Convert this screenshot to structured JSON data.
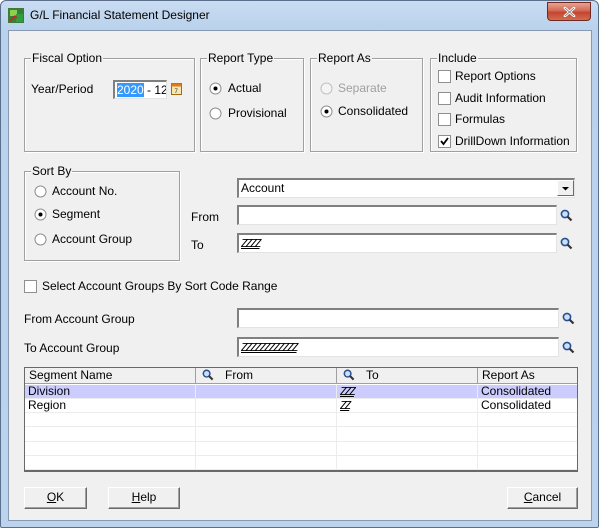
{
  "window": {
    "title": "G/L Financial Statement Designer",
    "icon": "app-icon",
    "close_icon": "close-icon"
  },
  "fiscal_option": {
    "legend": "Fiscal Option",
    "label": "Year/Period",
    "year": "2020",
    "separator": " - ",
    "period": "12",
    "calendar_icon": "calendar-icon"
  },
  "report_type": {
    "legend": "Report Type",
    "options": [
      {
        "label": "Actual",
        "checked": true
      },
      {
        "label": "Provisional",
        "checked": false
      }
    ]
  },
  "report_as": {
    "legend": "Report As",
    "options": [
      {
        "label": "Separate",
        "checked": false,
        "disabled": true
      },
      {
        "label": "Consolidated",
        "checked": true,
        "disabled": false
      }
    ]
  },
  "include": {
    "legend": "Include",
    "options": [
      {
        "label": "Report Options",
        "checked": false
      },
      {
        "label": "Audit Information",
        "checked": false
      },
      {
        "label": "Formulas",
        "checked": false
      },
      {
        "label": "DrillDown Information",
        "checked": true
      }
    ]
  },
  "sort_by": {
    "legend": "Sort By",
    "options": [
      {
        "label": "Account No.",
        "checked": false
      },
      {
        "label": "Segment",
        "checked": true
      },
      {
        "label": "Account Group",
        "checked": false
      }
    ]
  },
  "segment_select": {
    "value": "Account",
    "from_label": "From",
    "from_value": "",
    "to_label": "To",
    "to_value": "ZZZZ"
  },
  "sort_code_range": {
    "label": "Select Account Groups By Sort Code Range",
    "checked": false
  },
  "account_group": {
    "from_label": "From Account Group",
    "from_value": "",
    "to_label": "To Account Group",
    "to_value": "ZZZZZZZZZZZZ"
  },
  "grid": {
    "columns": [
      "Segment Name",
      "From",
      "To",
      "Report As"
    ],
    "rows": [
      {
        "segment_name": "Division",
        "from": "",
        "to": "ZZZ",
        "report_as": "Consolidated",
        "selected": true
      },
      {
        "segment_name": "Region",
        "from": "",
        "to": "ZZ",
        "report_as": "Consolidated",
        "selected": false
      }
    ]
  },
  "buttons": {
    "ok": {
      "mnemonic": "O",
      "rest": "K"
    },
    "help": {
      "mnemonic": "H",
      "rest": "elp"
    },
    "cancel": {
      "mnemonic": "C",
      "rest": "ancel"
    }
  }
}
